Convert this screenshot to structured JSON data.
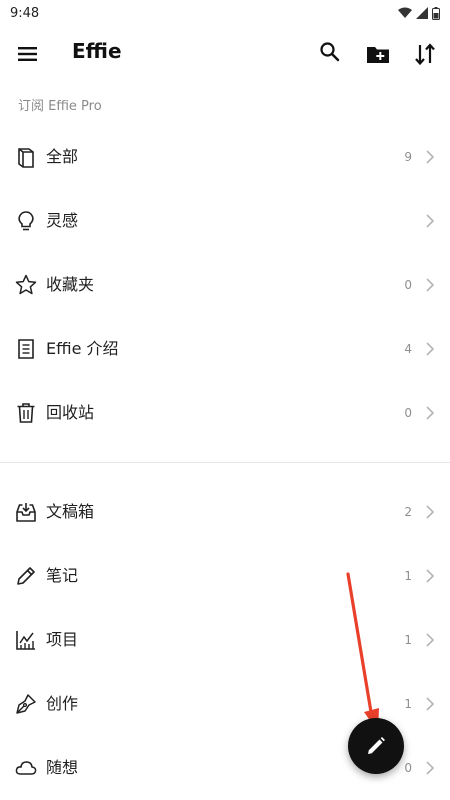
{
  "status_bar": {
    "time": "9:48"
  },
  "app_bar": {
    "title": "Effie"
  },
  "subscribe": {
    "label": "订阅 Effie Pro"
  },
  "library": [
    {
      "label": "全部",
      "count": "9",
      "icon": "notebook-icon"
    },
    {
      "label": "灵感",
      "count": "",
      "icon": "lightbulb-icon"
    },
    {
      "label": "收藏夹",
      "count": "0",
      "icon": "star-icon"
    },
    {
      "label": "Effie 介绍",
      "count": "4",
      "icon": "document-icon"
    },
    {
      "label": "回收站",
      "count": "0",
      "icon": "trash-icon"
    }
  ],
  "folders": [
    {
      "label": "文稿箱",
      "count": "2",
      "icon": "inbox-icon"
    },
    {
      "label": "笔记",
      "count": "1",
      "icon": "pencil-icon"
    },
    {
      "label": "项目",
      "count": "1",
      "icon": "chart-icon"
    },
    {
      "label": "创作",
      "count": "1",
      "icon": "pen-nib-icon"
    },
    {
      "label": "随想",
      "count": "0",
      "icon": "cloud-icon"
    }
  ],
  "colors": {
    "annotation_arrow": "#e8402a",
    "fab": "#111111"
  }
}
